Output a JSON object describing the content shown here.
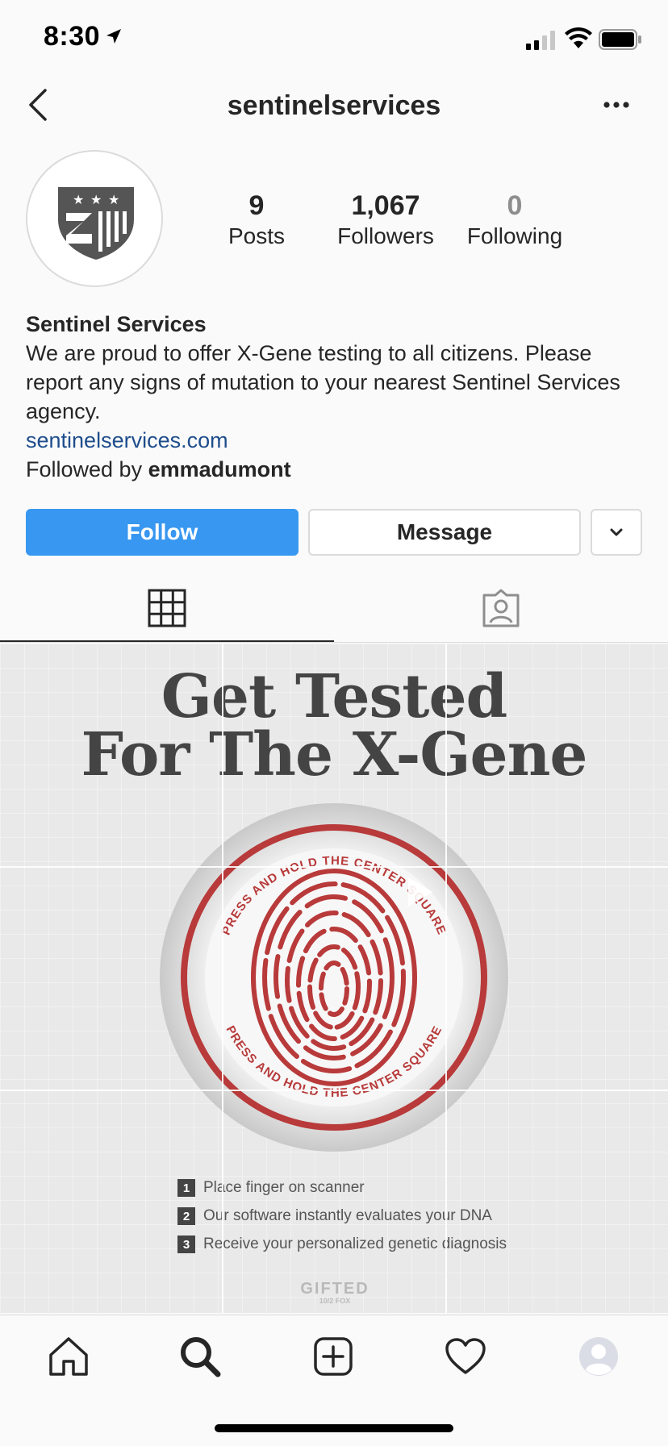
{
  "status_bar": {
    "time": "8:30"
  },
  "nav": {
    "title": "sentinelservices"
  },
  "stats": [
    {
      "value": "9",
      "label": "Posts"
    },
    {
      "value": "1,067",
      "label": "Followers"
    },
    {
      "value": "0",
      "label": "Following"
    }
  ],
  "bio": {
    "name": "Sentinel Services",
    "text": "We are proud to offer X-Gene testing to all citizens. Please report any signs of mutation to your nearest Sentinel Services agency.",
    "link": "sentinelservices.com",
    "followed_by_prefix": "Followed by ",
    "followed_by_user": "emmadumont"
  },
  "actions": {
    "follow": "Follow",
    "message": "Message"
  },
  "post": {
    "title_line1": "Get Tested",
    "title_line2": "For The X-Gene",
    "ring_text": "PRESS AND HOLD THE CENTER SQUARE",
    "steps": [
      {
        "num": "1",
        "text": "Place finger on scanner"
      },
      {
        "num": "2",
        "text": "Our software instantly evaluates your DNA"
      },
      {
        "num": "3",
        "text": "Receive your personalized genetic diagnosis"
      }
    ],
    "logo": "GIFTED",
    "logo_sub": "10/2 FOX"
  },
  "colors": {
    "follow_blue": "#3897f0",
    "link_blue": "#1e4d8c",
    "fingerprint_red": "#b83a3a"
  }
}
